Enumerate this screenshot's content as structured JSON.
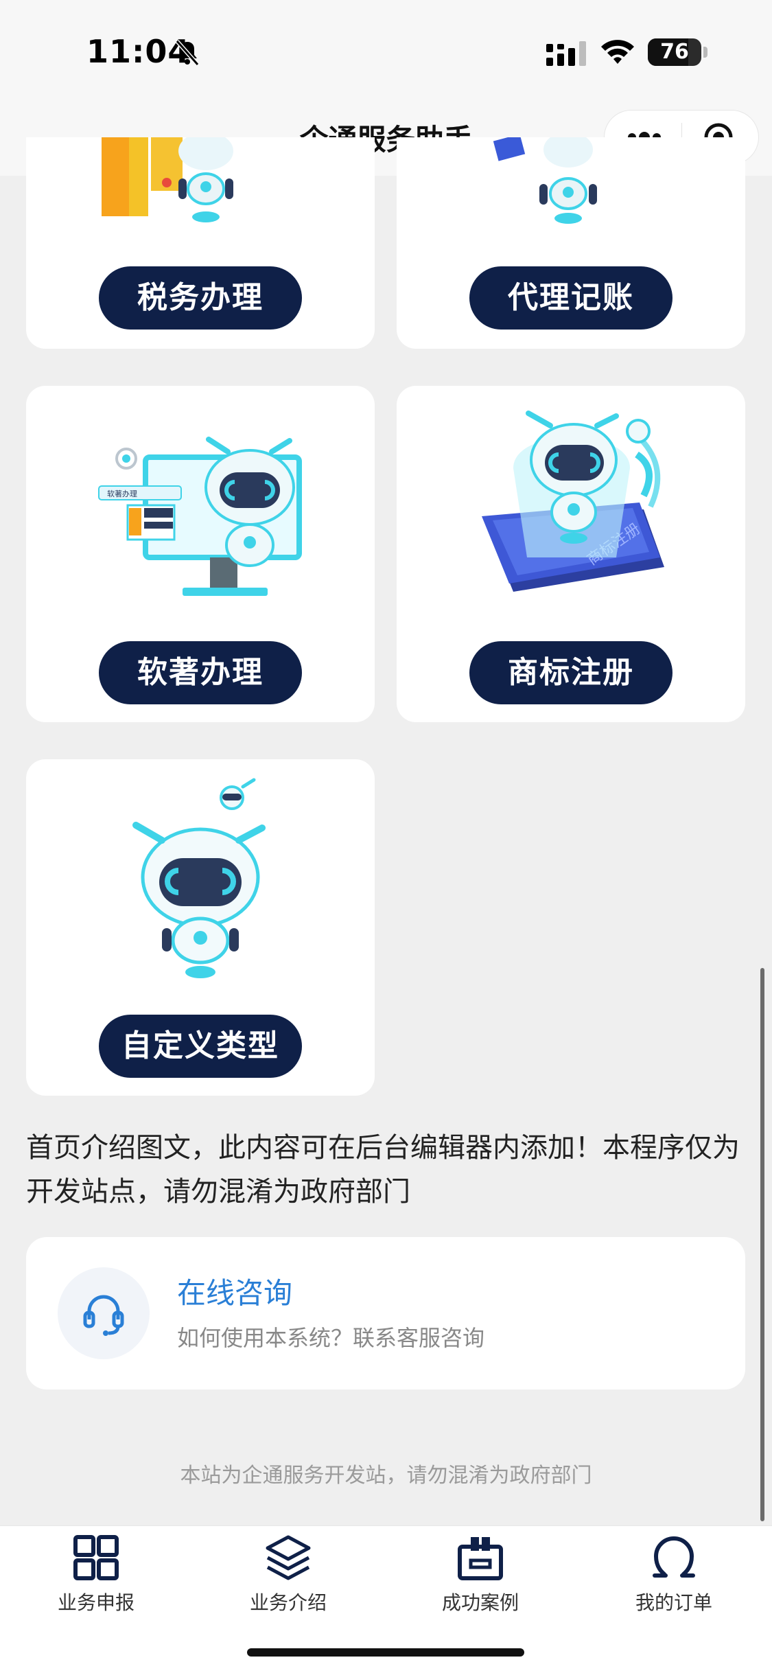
{
  "status": {
    "time": "11:04",
    "battery": "76",
    "battery_level": 0.76
  },
  "nav": {
    "title": "企通服务助手"
  },
  "services": [
    {
      "label": "税务办理"
    },
    {
      "label": "代理记账"
    },
    {
      "label": "软著办理"
    },
    {
      "label": "商标注册"
    },
    {
      "label": "自定义类型"
    }
  ],
  "art_text": {
    "search_box": "软著办理",
    "pad": "商标注册"
  },
  "intro": "首页介绍图文，此内容可在后台编辑器内添加！本程序仅为开发站点，请勿混淆为政府部门",
  "consult": {
    "title": "在线咨询",
    "subtitle": "如何使用本系统？联系客服咨询"
  },
  "footer_note": "本站为企通服务开发站，请勿混淆为政府部门",
  "tabs": [
    {
      "label": "业务申报",
      "icon": "grid-icon"
    },
    {
      "label": "业务介绍",
      "icon": "layers-icon"
    },
    {
      "label": "成功案例",
      "icon": "box-icon"
    },
    {
      "label": "我的订单",
      "icon": "person-icon"
    }
  ],
  "colors": {
    "accent": "#2a7fd6",
    "button": "#0f2048",
    "robot_cyan": "#3fd3e8",
    "robot_visor": "#2a3a5c"
  }
}
